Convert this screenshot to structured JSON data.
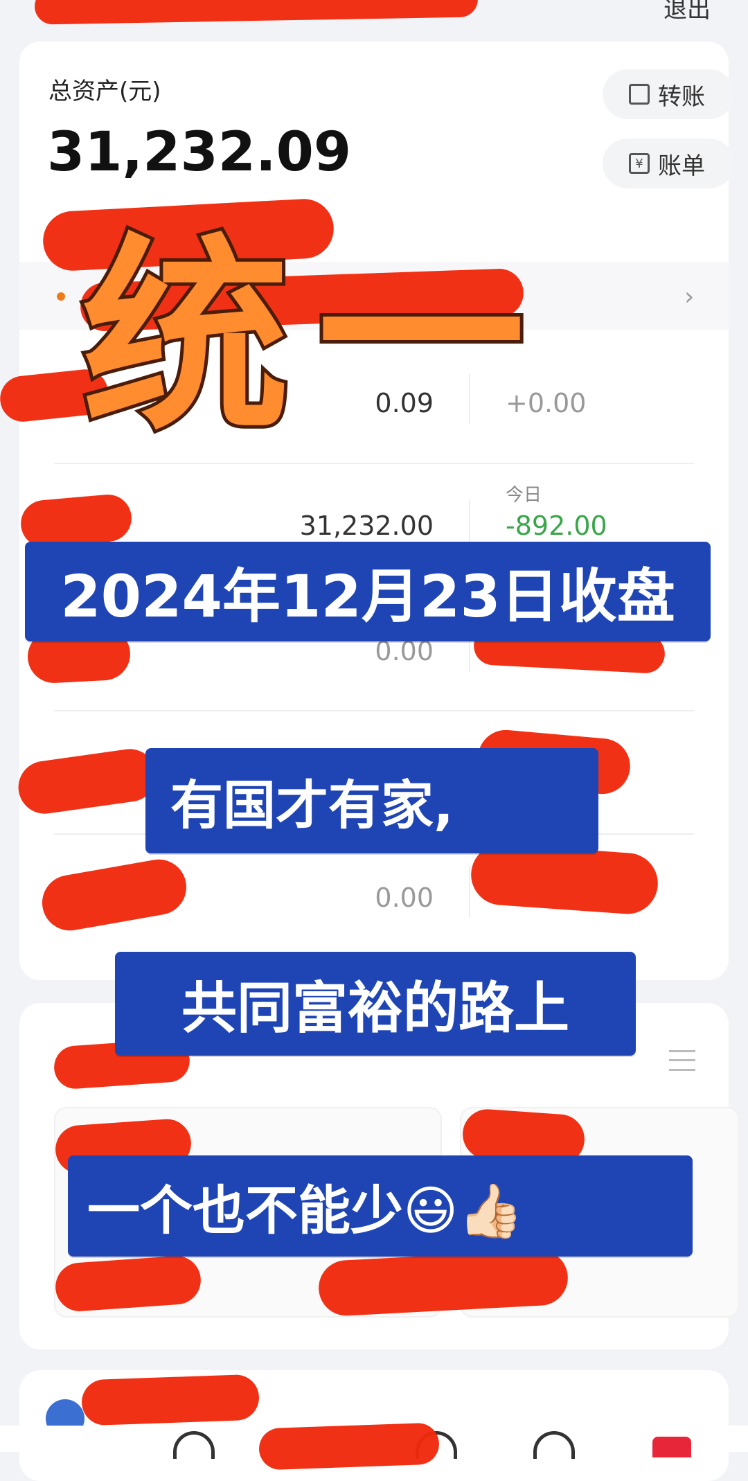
{
  "header": {
    "logout_label": "退出"
  },
  "assets": {
    "total_label": "总资产(元)",
    "total_value": "31,232.09",
    "transfer_label": "转账",
    "bill_label": "账单"
  },
  "rows": [
    {
      "value": "0.09",
      "change": "+0.00"
    },
    {
      "value": "31,232.00",
      "change_label": "今日",
      "change": "-892.00"
    },
    {
      "value": "0.00"
    },
    {
      "value": "0.00"
    }
  ],
  "overlay": {
    "big_title": "统一",
    "date_banner": "2024年12月23日收盘",
    "line1": "有国才有家,",
    "line2": "共同富裕的路上",
    "line3": "一个也不能少😃👍🏻"
  },
  "colors": {
    "accent_orange": "#ff8c2e",
    "banner_blue": "#1f45b5",
    "scribble_red": "#f12a0d",
    "loss_green": "#3aa64a"
  }
}
